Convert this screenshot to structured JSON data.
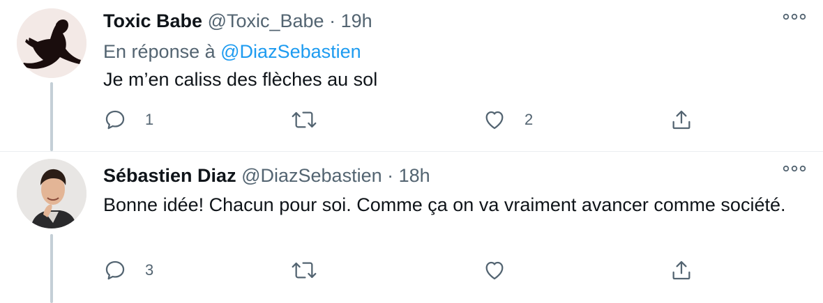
{
  "tweets": [
    {
      "display_name": "Toxic Babe",
      "handle": "@Toxic_Babe",
      "separator": "·",
      "time": "19h",
      "reply_prefix": "En réponse à",
      "reply_mention": "@DiazSebastien",
      "text": "Je m’en caliss des flèches au sol",
      "reply_count": "1",
      "retweet_count": "",
      "like_count": "2"
    },
    {
      "display_name": "Sébastien Diaz",
      "handle": "@DiazSebastien",
      "separator": "·",
      "time": "18h",
      "text": "Bonne idée! Chacun pour soi. Comme ça on va vraiment avancer comme société.",
      "reply_count": "3",
      "retweet_count": "",
      "like_count": ""
    }
  ],
  "colors": {
    "text": "#0f1419",
    "secondary": "#536471",
    "accent": "#1d9bf0",
    "thread_line": "#c4cfd6"
  },
  "icons": [
    "reply-icon",
    "retweet-icon",
    "like-icon",
    "share-icon",
    "more-icon"
  ]
}
